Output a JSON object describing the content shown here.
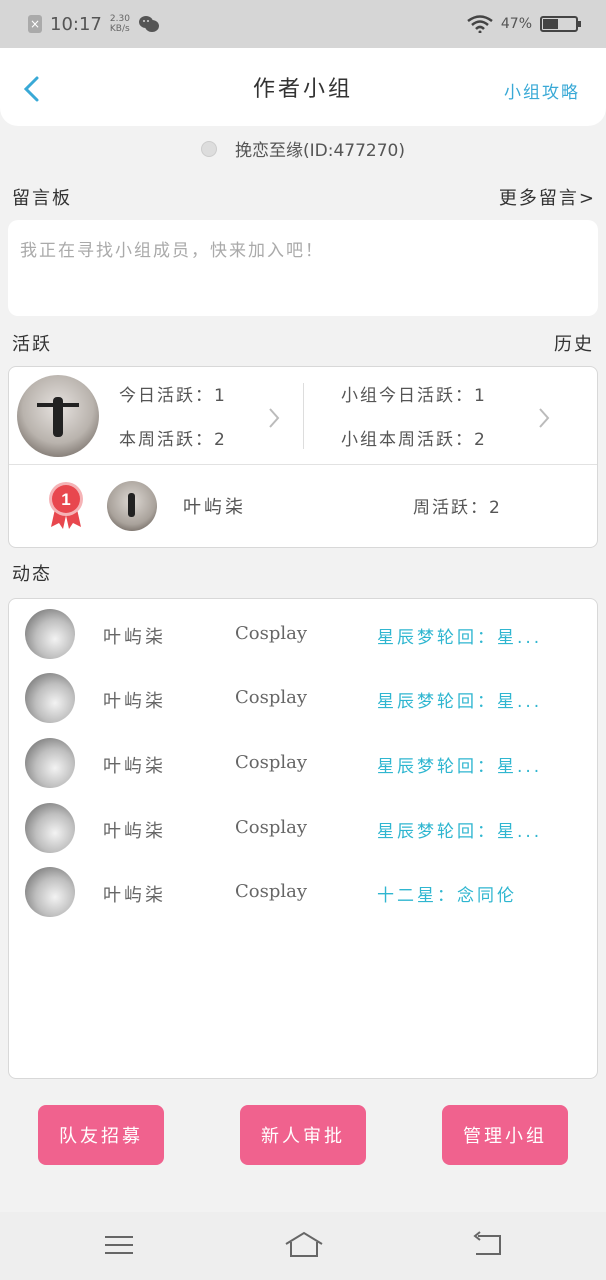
{
  "status_bar": {
    "time": "10:17",
    "speed_value": "2.30",
    "speed_unit": "KB/s",
    "battery": "47%",
    "battery_level": 0.47
  },
  "header": {
    "title": "作者小组",
    "right_link": "小组攻略"
  },
  "user": {
    "line": "挽恋至缘(ID:477270)"
  },
  "board": {
    "title": "留言板",
    "more": "更多留言>",
    "message": "我正在寻找小组成员，快来加入吧！"
  },
  "active": {
    "title": "活跃",
    "history": "历史",
    "today": "今日活跃：1",
    "week": "本周活跃：2",
    "group_today": "小组今日活跃：1",
    "group_week": "小组本周活跃：2",
    "rank": {
      "badge": "1",
      "name": "叶屿柒",
      "week": "周活跃：2"
    }
  },
  "feed": {
    "title": "动态",
    "items": [
      {
        "name": "叶屿柒",
        "category": "Cosplay",
        "work": "星辰梦轮回：星..."
      },
      {
        "name": "叶屿柒",
        "category": "Cosplay",
        "work": "星辰梦轮回：星..."
      },
      {
        "name": "叶屿柒",
        "category": "Cosplay",
        "work": "星辰梦轮回：星..."
      },
      {
        "name": "叶屿柒",
        "category": "Cosplay",
        "work": "星辰梦轮回：星..."
      },
      {
        "name": "叶屿柒",
        "category": "Cosplay",
        "work": "十二星：念同伦"
      }
    ]
  },
  "buttons": {
    "recruit": "队友招募",
    "approve": "新人审批",
    "manage": "管理小组"
  },
  "colors": {
    "accent_blue": "#39a9d6",
    "link_teal": "#2fb6d0",
    "button_pink": "#f0628e",
    "badge_red": "#e8474e"
  },
  "icons": {
    "back": "chevron-left-icon",
    "nav_menu": "menu-icon",
    "nav_home": "home-icon",
    "nav_back": "back-icon"
  }
}
